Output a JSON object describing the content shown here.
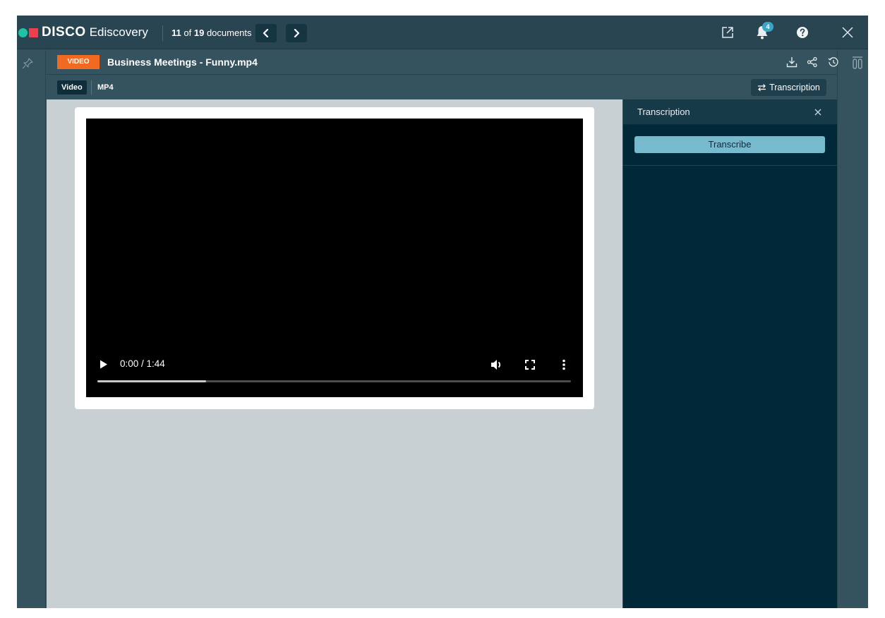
{
  "header": {
    "logo_text": "DISCO",
    "logo_sub": "Ediscovery",
    "logo_colors": {
      "dot": "#1fc2a7",
      "square": "#ee3f4f"
    },
    "doc_position": {
      "current": "11",
      "of_label": "of",
      "total": "19",
      "suffix": "documents"
    },
    "notification_count": "4"
  },
  "document": {
    "type_badge": "VIDEO",
    "title": "Business Meetings - Funny.mp4",
    "type_badge_color": "#f26a21"
  },
  "subbar": {
    "active_tab": "Video",
    "format": "MP4",
    "transcription_toggle": "Transcription"
  },
  "player": {
    "time": "0:00 / 1:44",
    "buffered_fraction": 0.23
  },
  "transcription_panel": {
    "title": "Transcription",
    "transcribe_label": "Transcribe"
  }
}
